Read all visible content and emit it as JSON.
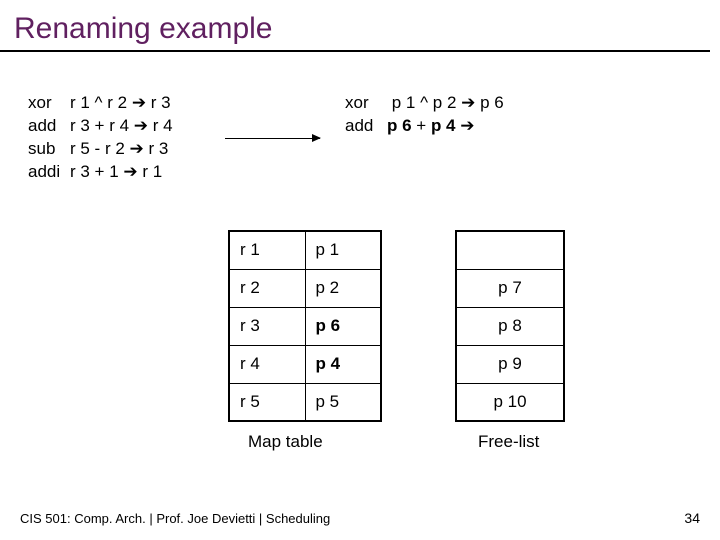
{
  "title": "Renaming example",
  "before": {
    "l1_op": "xor",
    "l1_rest": "r 1 ^ r 2 ➔ r 3",
    "l2_op": "add",
    "l2_rest": "r 3 + r 4 ➔ r 4",
    "l3_op": "sub",
    "l3_rest": "r 5 - r 2 ➔ r 3",
    "l4_op": "addi",
    "l4_rest": "r 3 + 1 ➔ r 1"
  },
  "after": {
    "l1_op": "xor",
    "l1_pre": " p 1 ^ p 2 ",
    "l1_arr": "➔",
    "l1_post": " p 6",
    "l2_op": "add",
    "l2_lhs": "p 6",
    "l2_mid": " + ",
    "l2_rhs": "p 4",
    "l2_arr": " ➔"
  },
  "map_table": {
    "rows": [
      {
        "r": "r 1",
        "p": "p 1",
        "bold": false
      },
      {
        "r": "r 2",
        "p": "p 2",
        "bold": false
      },
      {
        "r": "r 3",
        "p": "p 6",
        "bold": true
      },
      {
        "r": "r 4",
        "p": "p 4",
        "bold": true
      },
      {
        "r": "r 5",
        "p": "p 5",
        "bold": false
      }
    ],
    "caption": "Map table"
  },
  "free_list": {
    "rows": [
      "",
      "p 7",
      "p 8",
      "p 9",
      "p 10"
    ],
    "caption": "Free-list"
  },
  "footer": "CIS 501: Comp. Arch.  |  Prof. Joe Devietti  |  Scheduling",
  "page": "34"
}
